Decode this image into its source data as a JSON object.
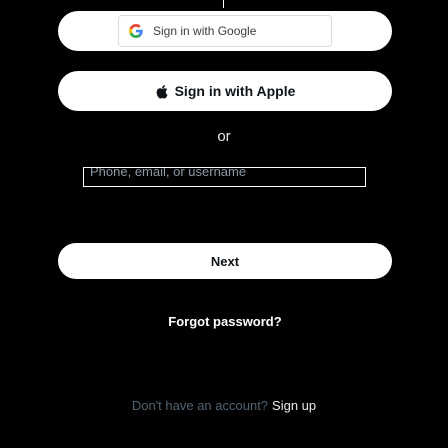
{
  "google_signin": {
    "label": "Sign in with Google",
    "icon": "google-g-icon"
  },
  "apple_signin": {
    "label": "Sign in with Apple",
    "icon": "apple-logo-icon"
  },
  "divider": {
    "text": "or"
  },
  "identifier_field": {
    "placeholder": "Phone, email, or username",
    "value": ""
  },
  "actions": {
    "next_label": "Next",
    "forgot_password_label": "Forgot password?"
  },
  "signup": {
    "prompt": "Don't have an account?",
    "link_label": "Sign up"
  },
  "colors": {
    "background": "#000000",
    "button_bg": "#ffffff",
    "button_text": "#0f1419",
    "muted_text": "#536471"
  }
}
